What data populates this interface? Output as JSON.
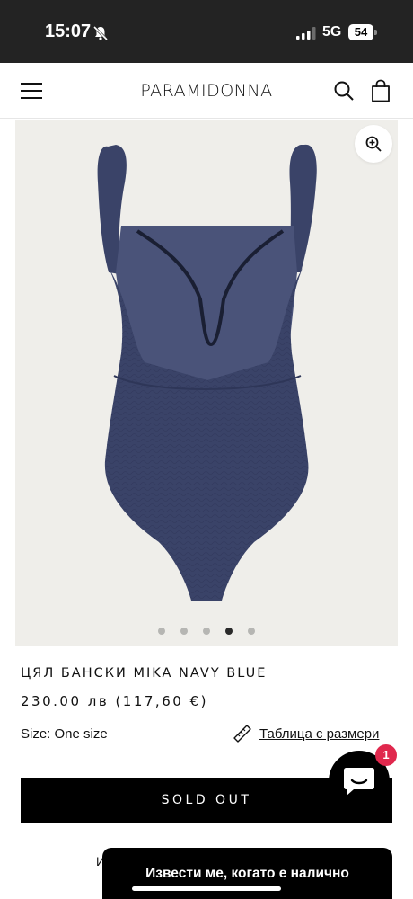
{
  "status_bar": {
    "time": "15:07",
    "network": "5G",
    "battery": "54"
  },
  "header": {
    "logo": "PARAMIDONNA",
    "menu_icon": "hamburger-menu-icon",
    "search_icon": "search-icon",
    "cart_icon": "shopping-bag-icon"
  },
  "gallery": {
    "zoom_icon": "zoom-in-icon",
    "slide_count": 5,
    "active_slide": 4
  },
  "product": {
    "title": "ЦЯЛ БАНСКИ MIKA NAVY BLUE",
    "price": "230.00 лв (117,60 €)",
    "size_text": "Size: One size",
    "size_chart_label": "Таблица с размери",
    "sold_out_label": "SOLD OUT",
    "partial_text": "И"
  },
  "chat": {
    "badge": "1"
  },
  "notify": {
    "label": "Извести ме, когато е налично"
  },
  "colors": {
    "status_bar_bg": "#232323",
    "gallery_bg": "#efeeea",
    "swimsuit": "#3a4368",
    "badge": "#e0284d"
  }
}
